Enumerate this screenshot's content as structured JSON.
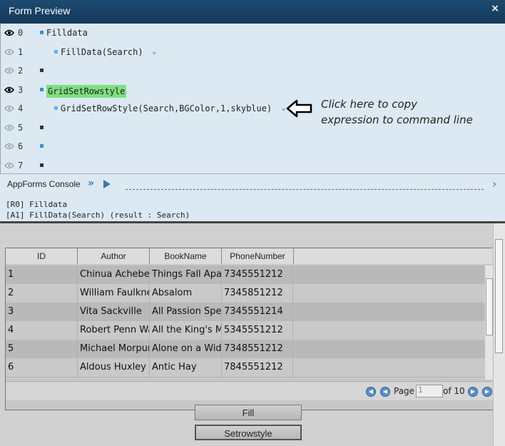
{
  "window": {
    "title": "Form Preview",
    "close": "×"
  },
  "expressions": [
    {
      "num": "0",
      "text": "Filldata",
      "eye": "visible",
      "indent": 0,
      "highlight": false,
      "chevron": false
    },
    {
      "num": "1",
      "text": "FillData(Search)",
      "eye": "hidden",
      "indent": 1,
      "highlight": false,
      "chevron": true
    },
    {
      "num": "2",
      "text": "",
      "eye": "hidden",
      "indent": 0,
      "highlight": false,
      "chevron": false
    },
    {
      "num": "3",
      "text": "GridSetRowstyle",
      "eye": "visible",
      "indent": 0,
      "highlight": true,
      "chevron": false
    },
    {
      "num": "4",
      "text": "GridSetRowStyle(Search,BGColor,1,skyblue)",
      "eye": "hidden",
      "indent": 1,
      "highlight": false,
      "chevron": true
    },
    {
      "num": "5",
      "text": "",
      "eye": "hidden",
      "indent": 0,
      "highlight": false,
      "chevron": false
    },
    {
      "num": "6",
      "text": "",
      "eye": "hidden",
      "indent": 0,
      "highlight": false,
      "chevron": false
    },
    {
      "num": "7",
      "text": "",
      "eye": "hidden",
      "indent": 0,
      "highlight": false,
      "chevron": false
    }
  ],
  "annotation": {
    "line1": "Click here to copy",
    "line2": "expression to command line"
  },
  "console": {
    "label": "AppForms Console",
    "output": [
      "[R0] Filldata",
      "[A1] FillData(Search) (result : Search)"
    ]
  },
  "grid": {
    "columns": [
      "ID",
      "Author",
      "BookName",
      "PhoneNumber"
    ],
    "rows": [
      [
        "1",
        "Chinua Achebe",
        "Things Fall Apart",
        "7345551212"
      ],
      [
        "2",
        "William Faulkner",
        "Absalom",
        "7345851212"
      ],
      [
        "3",
        "Vita Sackville",
        "All Passion Spent",
        "7345551214"
      ],
      [
        "4",
        "Robert Penn Warren",
        "All the King's Men",
        "5345551212"
      ],
      [
        "5",
        "Michael Morpurgo",
        "Alone on a Wide",
        "7348551212"
      ],
      [
        "6",
        "Aldous Huxley",
        "Antic Hay",
        "7845551212"
      ]
    ],
    "pager": {
      "page_label": "Page",
      "page_value": "1",
      "of_label": "of 10"
    }
  },
  "buttons": {
    "fill": "Fill",
    "setrowstyle": "Setrowstyle"
  },
  "colors": {
    "titlebar": "#1d4a6e",
    "panel": "#dce9f3",
    "highlight": "#7ee07e",
    "accent": "#3a76b8"
  }
}
